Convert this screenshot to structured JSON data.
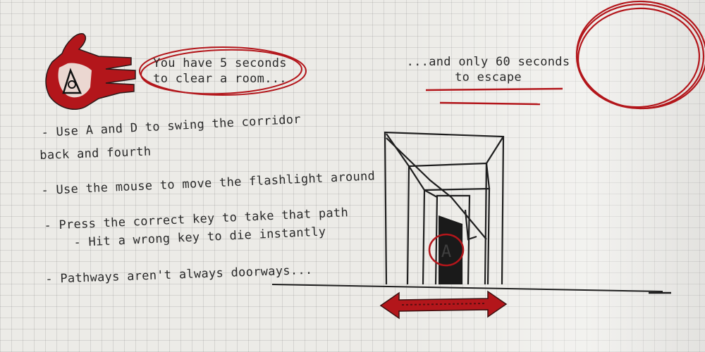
{
  "intro": {
    "left_line1": "You have 5 seconds",
    "left_line2": "to clear a room...",
    "right_line1": "...and only 60 seconds",
    "right_line2": "to escape"
  },
  "rules": {
    "swing_line1": "- Use A and D to swing the corridor",
    "swing_line2": "back and fourth",
    "flashlight": "- Use the mouse to move the flashlight around",
    "correct_key": "- Press the correct key to take that path",
    "wrong_key": "- Hit a wrong key to die instantly",
    "pathways": "- Pathways aren't always doorways..."
  },
  "door_key_label": "A",
  "colors": {
    "accent_red": "#b3161b",
    "ink": "#2a2a2a",
    "paper": "#ecebe7"
  },
  "icons": {
    "hand": "red-hand-icon",
    "swing_arrow": "double-arrow-icon"
  }
}
